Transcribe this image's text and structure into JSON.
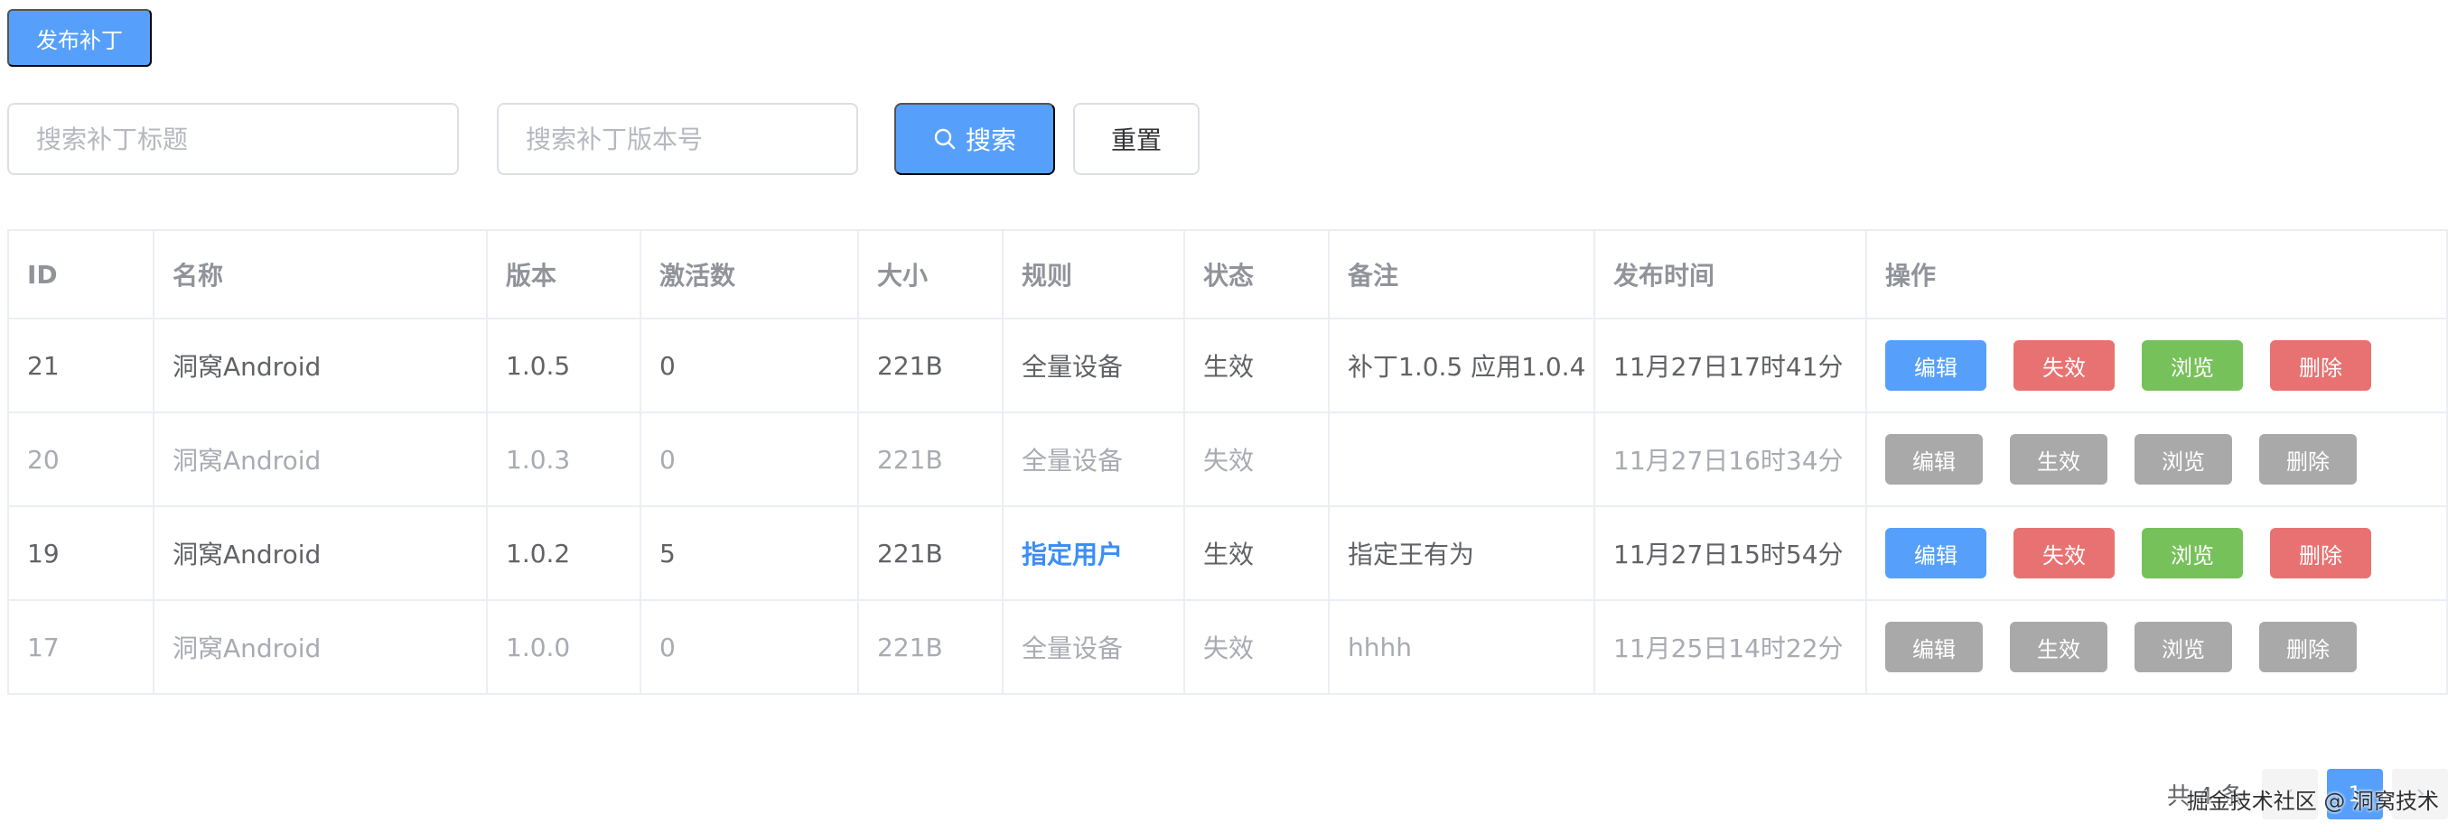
{
  "toolbar": {
    "publish_label": "发布补丁"
  },
  "search": {
    "title_placeholder": "搜索补丁标题",
    "version_placeholder": "搜索补丁版本号",
    "search_label": "搜索",
    "reset_label": "重置"
  },
  "table": {
    "headers": [
      "ID",
      "名称",
      "版本",
      "激活数",
      "大小",
      "规则",
      "状态",
      "备注",
      "发布时间",
      "操作"
    ],
    "rows": [
      {
        "id": "21",
        "name": "洞窝Android",
        "version": "1.0.5",
        "activations": "0",
        "size": "221B",
        "rule": "全量设备",
        "status": "生效",
        "note": "补丁1.0.5 应用1.0.4",
        "time": "11月27日17时41分",
        "actions": [
          "编辑",
          "失效",
          "浏览",
          "删除"
        ]
      },
      {
        "id": "20",
        "name": "洞窝Android",
        "version": "1.0.3",
        "activations": "0",
        "size": "221B",
        "rule": "全量设备",
        "status": "失效",
        "note": "",
        "time": "11月27日16时34分",
        "actions": [
          "编辑",
          "生效",
          "浏览",
          "删除"
        ]
      },
      {
        "id": "19",
        "name": "洞窝Android",
        "version": "1.0.2",
        "activations": "5",
        "size": "221B",
        "rule": "指定用户",
        "status": "生效",
        "note": "指定王有为",
        "time": "11月27日15时54分",
        "actions": [
          "编辑",
          "失效",
          "浏览",
          "删除"
        ]
      },
      {
        "id": "17",
        "name": "洞窝Android",
        "version": "1.0.0",
        "activations": "0",
        "size": "221B",
        "rule": "全量设备",
        "status": "失效",
        "note": "hhhh",
        "time": "11月25日14时22分",
        "actions": [
          "编辑",
          "生效",
          "浏览",
          "删除"
        ]
      }
    ]
  },
  "pagination": {
    "total_label": "共 4 条",
    "current_page": "1"
  },
  "watermark": "掘金技术社区 @ 洞窝技术",
  "colors": {
    "primary": "#56a0fb",
    "danger": "#e87272",
    "success": "#77c15a",
    "disabled": "#a9a9a9"
  }
}
